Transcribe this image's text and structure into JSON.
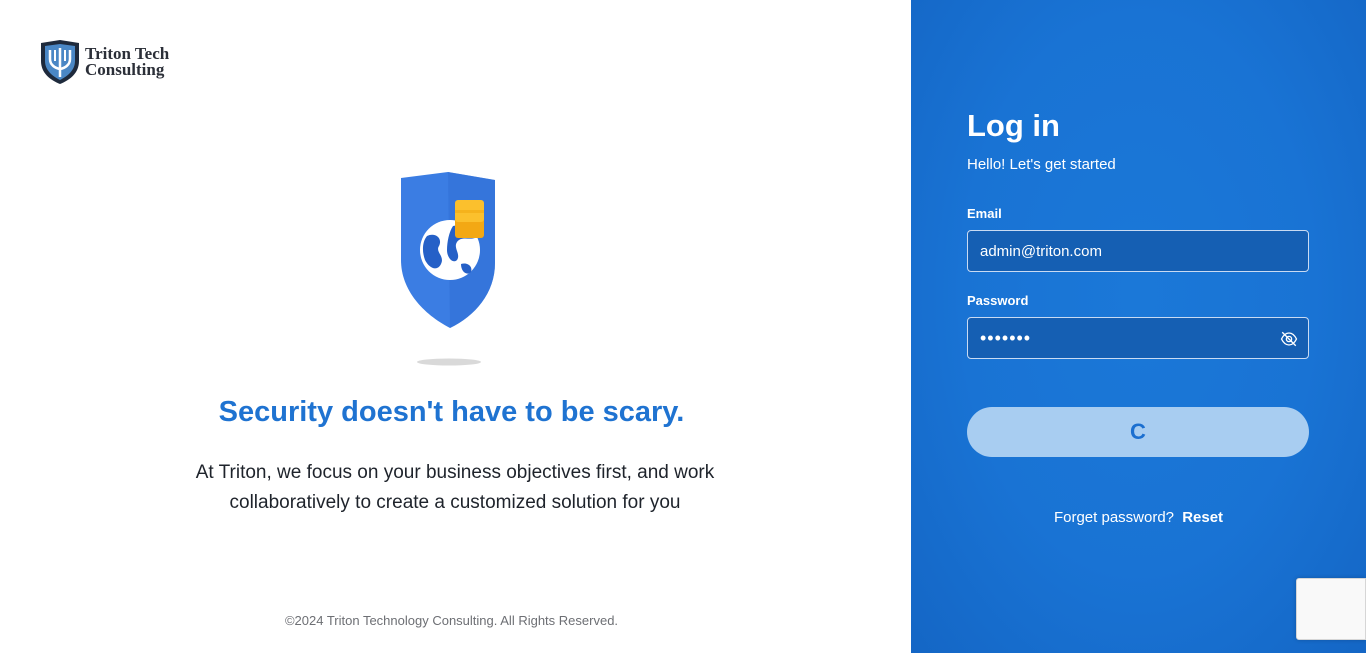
{
  "brand": {
    "name_line1": "Triton Tech",
    "name_line2": "Consulting"
  },
  "hero": {
    "headline": "Security doesn't have to be scary.",
    "tagline": "At Triton, we focus on your business objectives first, and work collaboratively to create a customized solution for you",
    "illustration_icon": "shield-globe-icon"
  },
  "footer": {
    "copyright": "©2024 Triton Technology Consulting. All Rights Reserved."
  },
  "login": {
    "title": "Log in",
    "subtitle": "Hello! Let's get started",
    "email_label": "Email",
    "email_value": "admin@triton.com",
    "password_label": "Password",
    "password_value": "•••••••",
    "submit_spinner": "C",
    "forgot_text": "Forget password?",
    "reset_link": "Reset"
  },
  "colors": {
    "accent_blue": "#1f73d1",
    "panel_blue": "#1973d4",
    "button_disabled": "#a8cdf1"
  }
}
